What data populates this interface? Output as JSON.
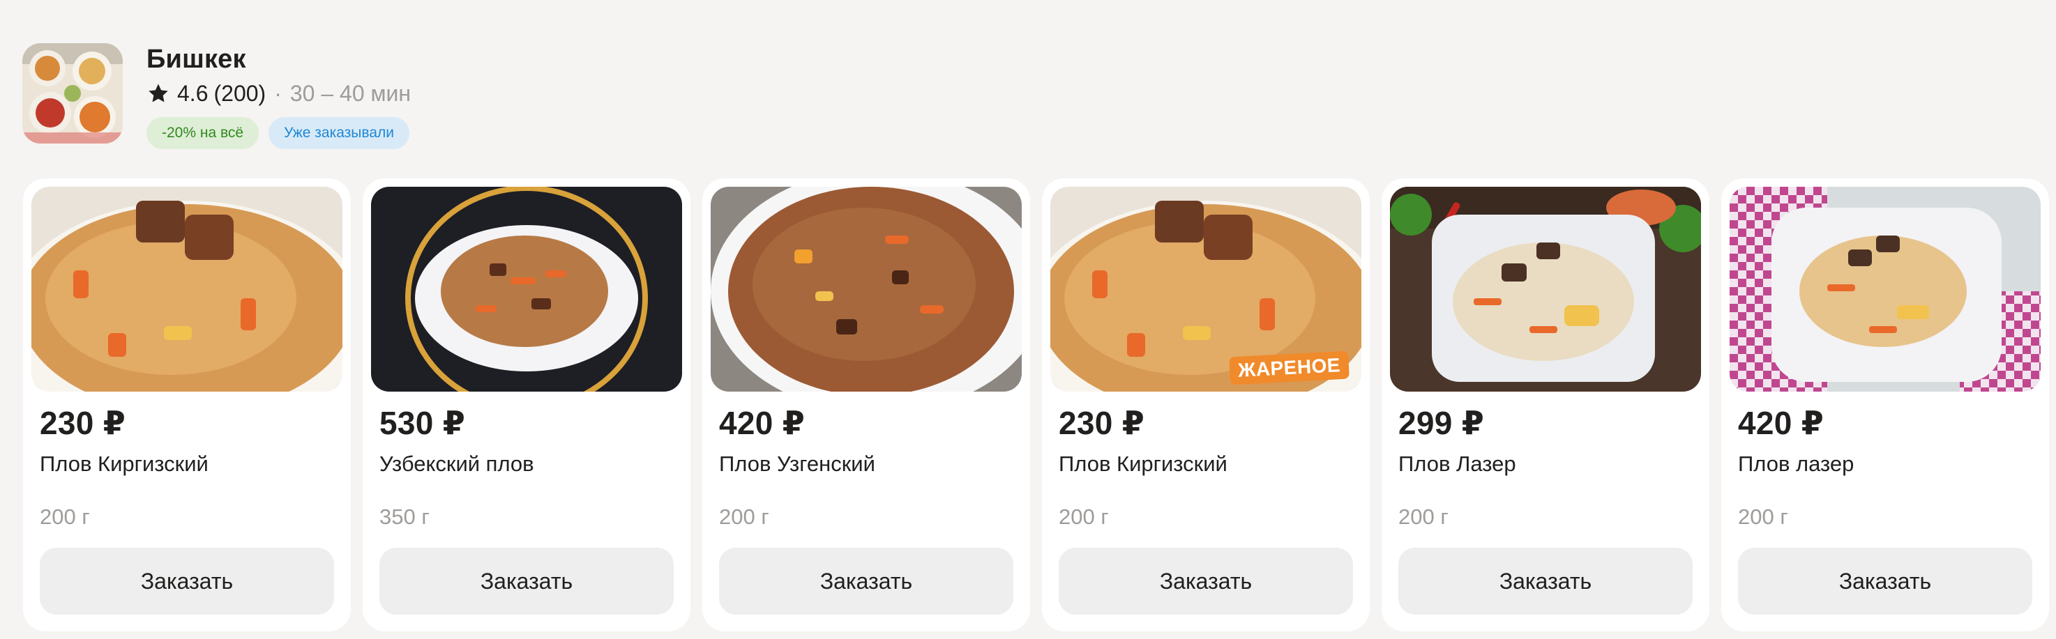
{
  "restaurant": {
    "name": "Бишкек",
    "rating": "4.6",
    "reviews": "(200)",
    "separator": "·",
    "delivery_time": "30 – 40 мин",
    "badges": {
      "discount": "-20% на всё",
      "ordered": "Уже заказывали"
    }
  },
  "colors": {
    "accent_green": "#2f8a1e",
    "accent_blue": "#1e88d6",
    "badge_orange": "#f08a2a"
  },
  "cards": [
    {
      "price": "230 ₽",
      "name": "Плов Киргизский",
      "weight": "200 г",
      "button": "Заказать",
      "photo": "plov-kirgizskiy-photo"
    },
    {
      "price": "530 ₽",
      "name": "Узбекский плов",
      "weight": "350 г",
      "button": "Заказать",
      "photo": "uzbek-plov-photo"
    },
    {
      "price": "420 ₽",
      "name": "Плов Узгенский",
      "weight": "200 г",
      "button": "Заказать",
      "photo": "plov-uzgenskiy-photo"
    },
    {
      "price": "230 ₽",
      "name": "Плов Киргизский",
      "weight": "200 г",
      "button": "Заказать",
      "photo": "plov-kirgizskiy-fried-photo",
      "badge": "ЖАРЕНОЕ"
    },
    {
      "price": "299 ₽",
      "name": "Плов Лазер",
      "weight": "200 г",
      "button": "Заказать",
      "photo": "plov-lazer-photo"
    },
    {
      "price": "420 ₽",
      "name": "Плов лазер",
      "weight": "200 г",
      "button": "Заказать",
      "photo": "plov-lazer-2-photo"
    }
  ]
}
